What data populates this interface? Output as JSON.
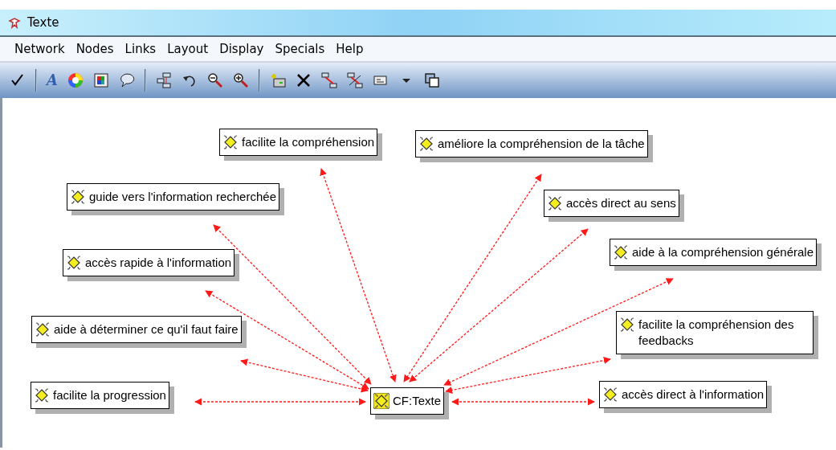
{
  "window": {
    "title": "Texte"
  },
  "menu": [
    "Network",
    "Nodes",
    "Links",
    "Layout",
    "Display",
    "Specials",
    "Help"
  ],
  "toolbar": [
    {
      "kind": "check"
    },
    {
      "kind": "sep"
    },
    {
      "kind": "font",
      "glyph": "A"
    },
    {
      "kind": "color"
    },
    {
      "kind": "palette"
    },
    {
      "kind": "bubble"
    },
    {
      "kind": "sep"
    },
    {
      "kind": "tree"
    },
    {
      "kind": "undo"
    },
    {
      "kind": "zoomout"
    },
    {
      "kind": "zoomin"
    },
    {
      "kind": "sep"
    },
    {
      "kind": "newnode"
    },
    {
      "kind": "delete"
    },
    {
      "kind": "link"
    },
    {
      "kind": "unlink"
    },
    {
      "kind": "label"
    },
    {
      "kind": "dropdown"
    },
    {
      "kind": "copy"
    }
  ],
  "network": {
    "center": {
      "label": "CF:Texte"
    },
    "nodes": [
      {
        "label": "facilite la compréhension"
      },
      {
        "label": "améliore la compréhension de la tâche"
      },
      {
        "label": "guide vers l'information recherchée"
      },
      {
        "label": "accès direct au sens"
      },
      {
        "label": "accès rapide à l'information"
      },
      {
        "label": "aide à la compréhension générale"
      },
      {
        "label": "aide à déterminer ce qu'il faut faire"
      },
      {
        "label": "facilite la compréhension des feedbacks"
      },
      {
        "label": "facilite la progression"
      },
      {
        "label": "accès direct à l'information"
      }
    ]
  }
}
